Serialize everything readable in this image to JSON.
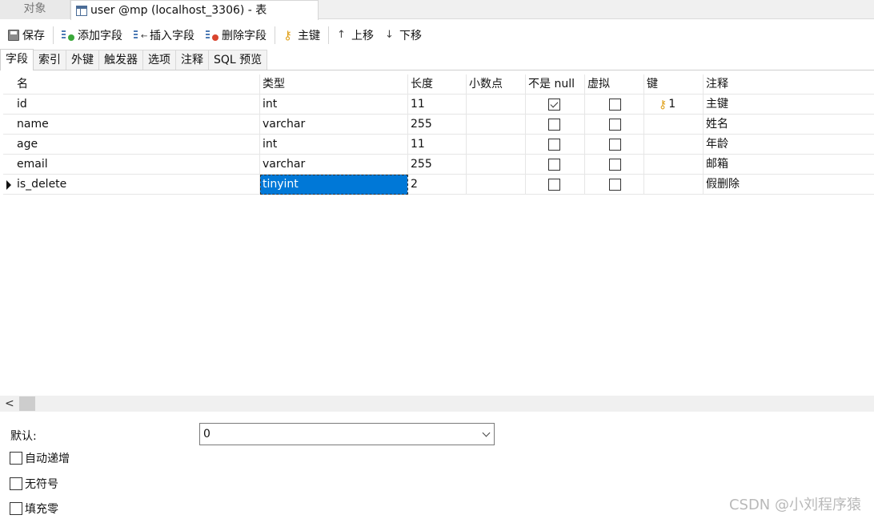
{
  "window_tabs": {
    "objects": "对象",
    "active_title": "user @mp (localhost_3306) - 表"
  },
  "toolbar": {
    "save": "保存",
    "add_field": "添加字段",
    "insert_field": "插入字段",
    "delete_field": "删除字段",
    "primary_key": "主键",
    "move_up": "上移",
    "move_down": "下移"
  },
  "subtabs": [
    "字段",
    "索引",
    "外键",
    "触发器",
    "选项",
    "注释",
    "SQL 预览"
  ],
  "grid": {
    "headers": {
      "name": "名",
      "type": "类型",
      "length": "长度",
      "decimals": "小数点",
      "not_null": "不是 null",
      "virtual": "虚拟",
      "key": "键",
      "comment": "注释"
    },
    "rows": [
      {
        "name": "id",
        "type": "int",
        "length": "11",
        "decimals": "",
        "not_null": true,
        "virtual": false,
        "key": "1",
        "comment": "主键"
      },
      {
        "name": "name",
        "type": "varchar",
        "length": "255",
        "decimals": "",
        "not_null": false,
        "virtual": false,
        "key": "",
        "comment": "姓名"
      },
      {
        "name": "age",
        "type": "int",
        "length": "11",
        "decimals": "",
        "not_null": false,
        "virtual": false,
        "key": "",
        "comment": "年龄"
      },
      {
        "name": "email",
        "type": "varchar",
        "length": "255",
        "decimals": "",
        "not_null": false,
        "virtual": false,
        "key": "",
        "comment": "邮箱"
      },
      {
        "name": "is_delete",
        "type": "tinyint",
        "length": "2",
        "decimals": "",
        "not_null": false,
        "virtual": false,
        "key": "",
        "comment": "假删除"
      }
    ],
    "selected_row": 4
  },
  "props": {
    "default_label": "默认:",
    "default_value": "0",
    "auto_increment": "自动递增",
    "unsigned": "无符号",
    "zerofill": "填充零"
  },
  "watermark": "CSDN @小刘程序猿",
  "colors": {
    "selection": "#0078d7",
    "key_icon": "#e0a11b"
  }
}
